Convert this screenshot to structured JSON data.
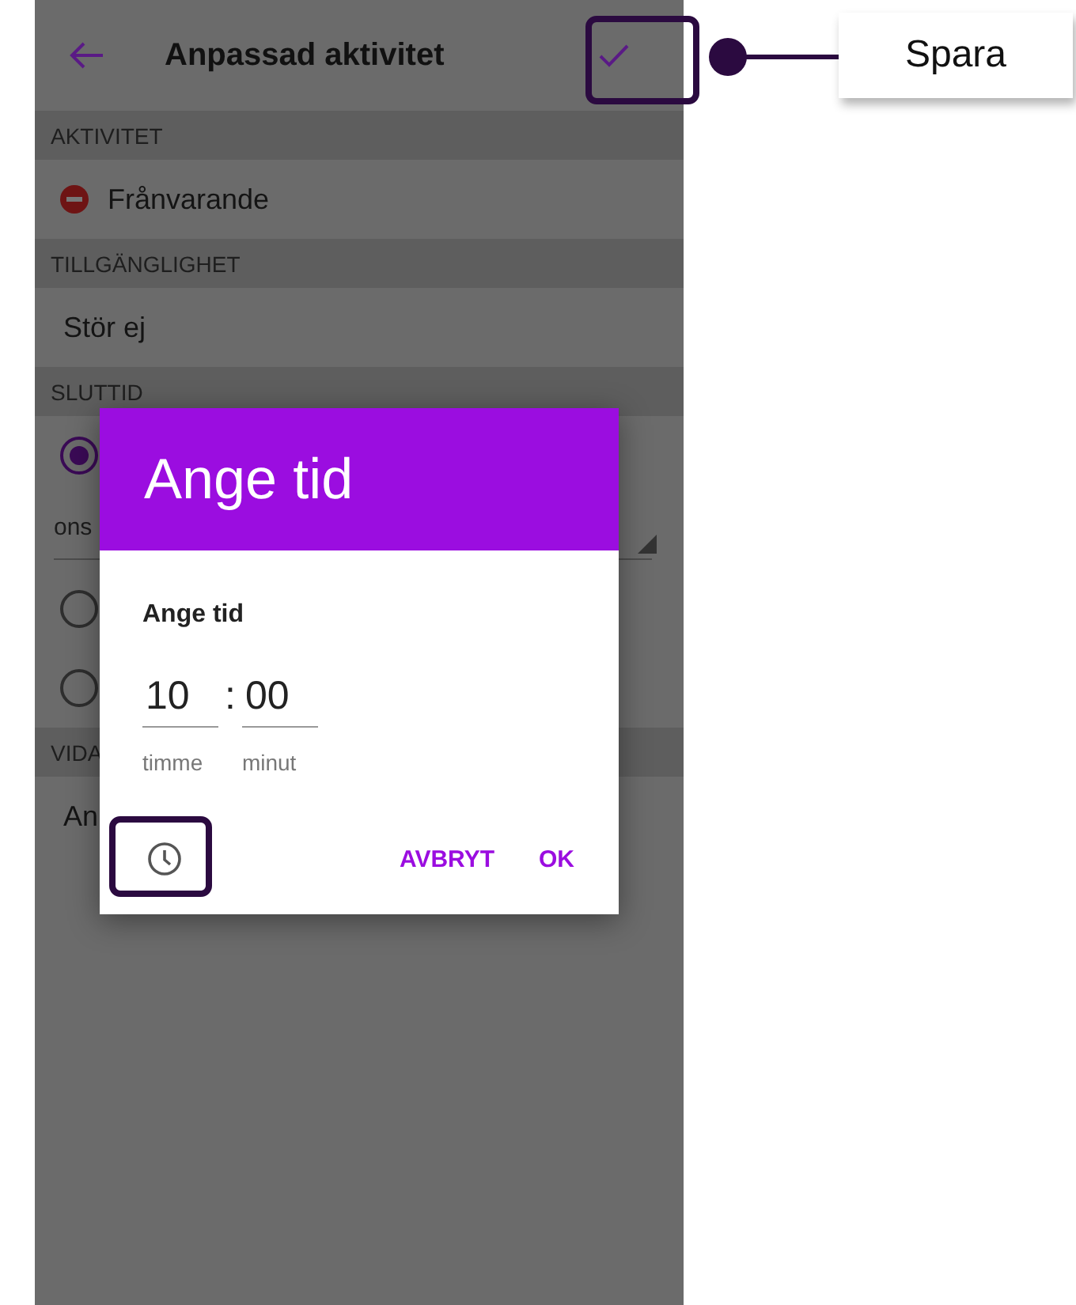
{
  "header": {
    "title": "Anpassad aktivitet"
  },
  "sections": [
    {
      "heading": "AKTIVITET",
      "items": [
        {
          "kind": "status",
          "text": "Frånvarande"
        }
      ]
    },
    {
      "heading": "TILLGÄNGLIGHET",
      "items": [
        {
          "kind": "text",
          "text": "Stör ej"
        }
      ]
    },
    {
      "heading": "SLUTTID",
      "items": [
        {
          "kind": "radio",
          "selected": true
        },
        {
          "kind": "dropdown",
          "text": "ons"
        },
        {
          "kind": "radio",
          "selected": false
        },
        {
          "kind": "radio",
          "selected": false
        }
      ]
    },
    {
      "heading": "VIDA",
      "items": [
        {
          "kind": "text",
          "text": "An"
        }
      ]
    }
  ],
  "dialog": {
    "title": "Ange tid",
    "label": "Ange tid",
    "hour": "10",
    "separator": ":",
    "minute": "00",
    "hour_caption": "timme",
    "minute_caption": "minut",
    "buttons": [
      "AVBRYT",
      "OK"
    ]
  },
  "callout": {
    "label": "Spara"
  }
}
